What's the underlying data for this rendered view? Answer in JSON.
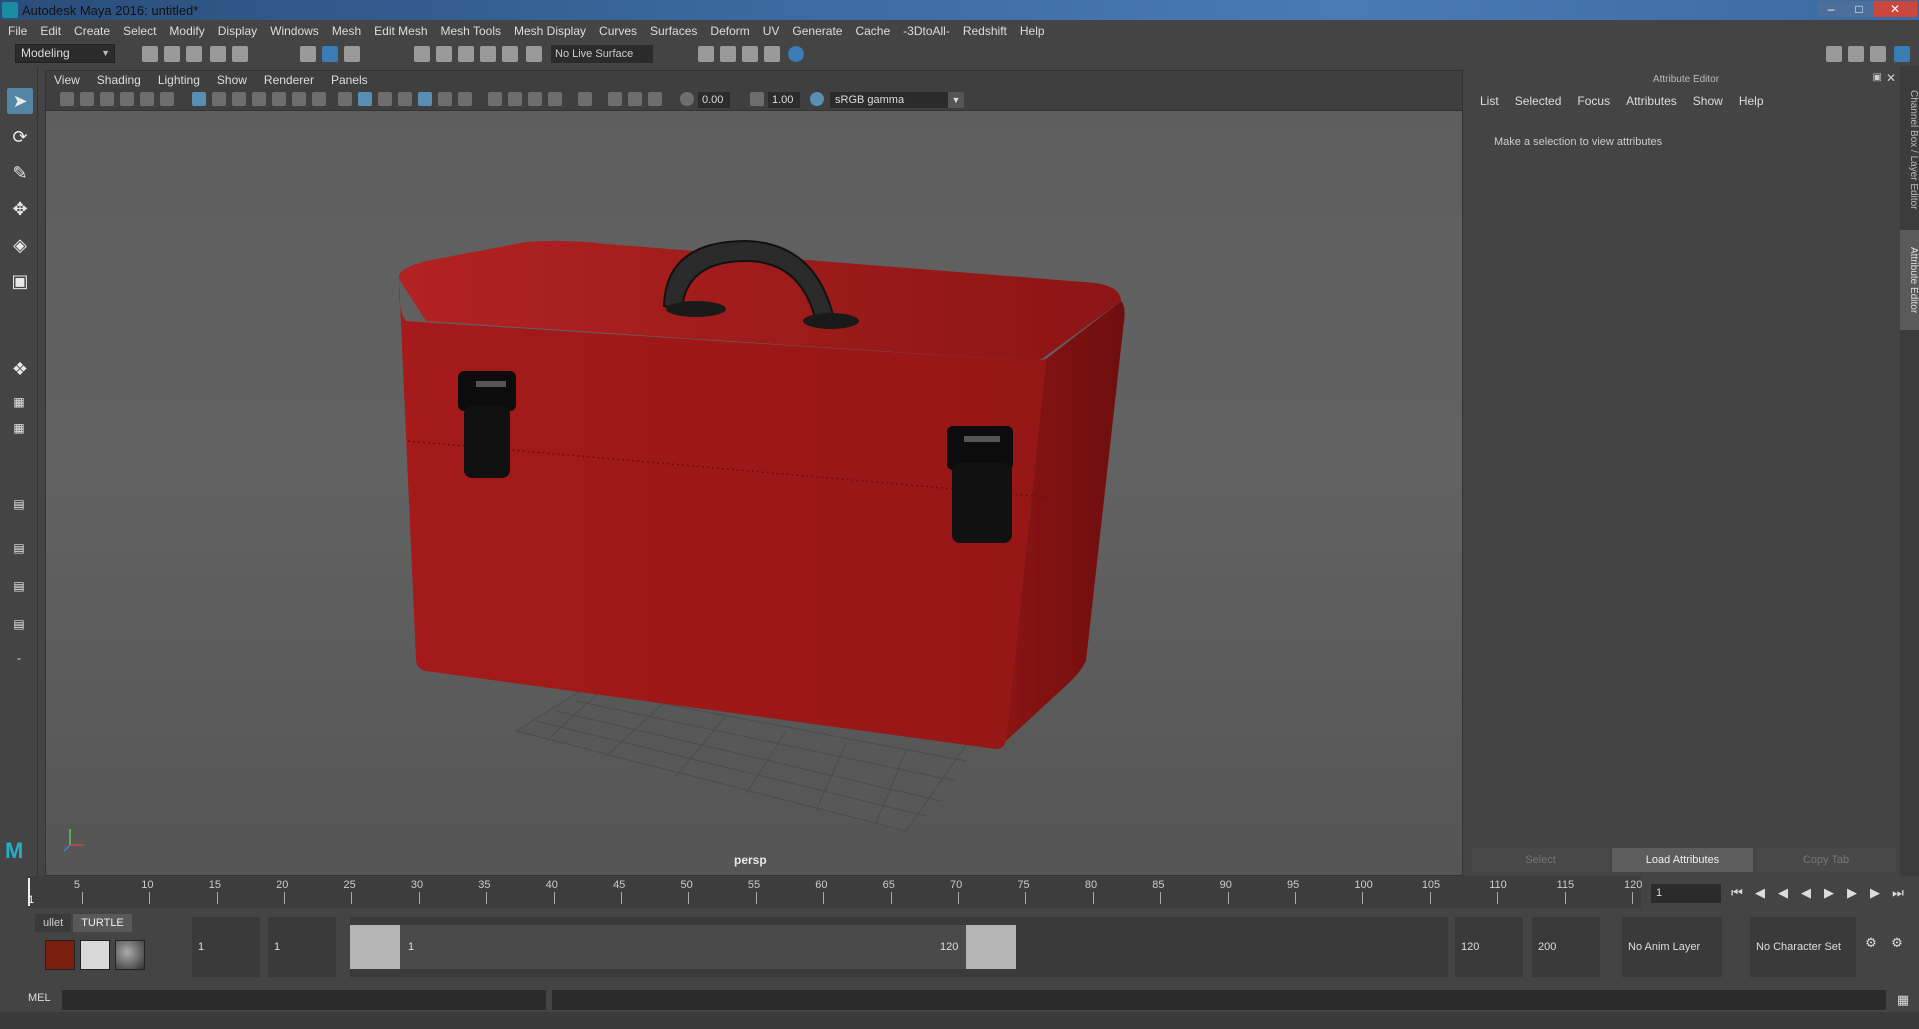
{
  "window": {
    "title": "Autodesk Maya 2016: untitled*"
  },
  "menus": [
    "File",
    "Edit",
    "Create",
    "Select",
    "Modify",
    "Display",
    "Windows",
    "Mesh",
    "Edit Mesh",
    "Mesh Tools",
    "Mesh Display",
    "Curves",
    "Surfaces",
    "Deform",
    "UV",
    "Generate",
    "Cache",
    "-3DtoAll-",
    "Redshift",
    "Help"
  ],
  "statusline": {
    "mode": "Modeling",
    "live_surface": "No Live Surface"
  },
  "viewport": {
    "menus": [
      "View",
      "Shading",
      "Lighting",
      "Show",
      "Renderer",
      "Panels"
    ],
    "exposure": "0.00",
    "gamma": "1.00",
    "colorspace": "sRGB gamma",
    "camera": "persp"
  },
  "attribute_editor": {
    "title": "Attribute Editor",
    "menus": [
      "List",
      "Selected",
      "Focus",
      "Attributes",
      "Show",
      "Help"
    ],
    "message": "Make a selection to view attributes",
    "buttons": {
      "select": "Select",
      "load": "Load Attributes",
      "copy": "Copy Tab"
    }
  },
  "side_tabs": {
    "channel_box": "Channel Box / Layer Editor",
    "attribute_editor": "Attribute Editor"
  },
  "timeline": {
    "ticks": [
      "5",
      "10",
      "15",
      "20",
      "25",
      "30",
      "35",
      "40",
      "45",
      "50",
      "55",
      "60",
      "65",
      "70",
      "75",
      "80",
      "85",
      "90",
      "95",
      "100",
      "105",
      "110",
      "115",
      "120"
    ],
    "current_label": "1",
    "current_frame": "1",
    "range_start": 1,
    "range_end": 120
  },
  "shelf": {
    "tabs": [
      "ullet",
      "TURTLE"
    ]
  },
  "range": {
    "start_time": "1",
    "playback_start": "1",
    "slider_start": "1",
    "slider_end": "120",
    "playback_end": "120",
    "end_time": "200",
    "anim_layer": "No Anim Layer",
    "character_set": "No Character Set"
  },
  "cmd": {
    "label": "MEL"
  },
  "colors": {
    "toolbox_red": "#a51a1a",
    "accent": "#5285a6"
  }
}
